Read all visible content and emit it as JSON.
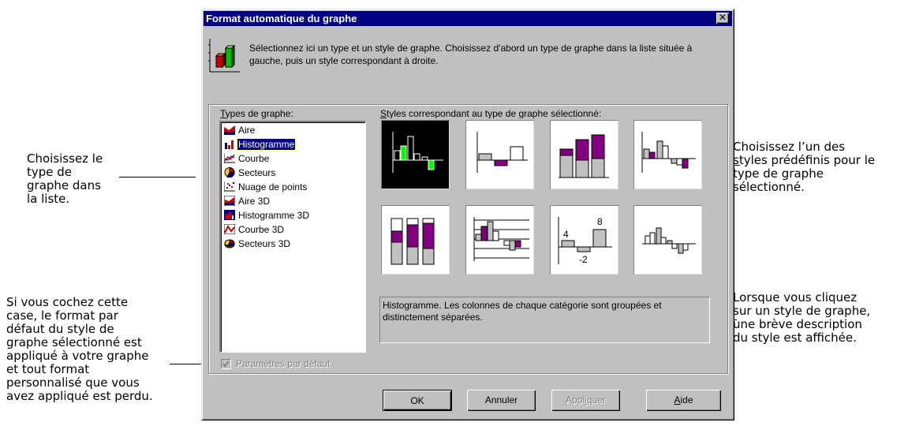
{
  "dialog": {
    "title": "Format automatique du graphe",
    "intro": "Sélectionnez ici un type et un style de graphe. Choisissez d'abord un type de graphe dans la liste située à gauche, puis un style correspondant à droite.",
    "types_label_first": "T",
    "types_label_rest": "ypes de graphe:",
    "styles_label_first": "S",
    "styles_label_rest": "tyles correspondant au type de graphe sélectionné:",
    "chart_types": [
      {
        "label": "Aire",
        "icon": "area-chart-icon"
      },
      {
        "label": "Histogramme",
        "icon": "column-chart-icon",
        "selected": true
      },
      {
        "label": "Courbe",
        "icon": "line-chart-icon"
      },
      {
        "label": "Secteurs",
        "icon": "pie-chart-icon"
      },
      {
        "label": "Nuage de points",
        "icon": "scatter-chart-icon"
      },
      {
        "label": "Aire 3D",
        "icon": "area-3d-chart-icon"
      },
      {
        "label": "Histogramme 3D",
        "icon": "column-3d-chart-icon"
      },
      {
        "label": "Courbe 3D",
        "icon": "line-3d-chart-icon"
      },
      {
        "label": "Secteurs 3D",
        "icon": "pie-3d-chart-icon"
      }
    ],
    "style_labels": {
      "val_4": "4",
      "val_neg2": "-2",
      "val_8": "8"
    },
    "description": "Histogramme. Les colonnes de chaque catégorie sont groupées et distinctement séparées.",
    "checkbox_label": "Paramètres par défaut",
    "buttons": {
      "ok": "OK",
      "cancel": "Annuler",
      "apply_pre": "Appl",
      "apply_u": "i",
      "apply_post": "quer",
      "help_u": "A",
      "help_post": "ide"
    }
  },
  "callouts": {
    "left_top": [
      "Choisissez le",
      "type de",
      "graphe dans",
      "la liste."
    ],
    "left_bottom": [
      "Si vous cochez cette",
      "case, le format par",
      "défaut du style de",
      "graphe sélectionné est",
      "appliqué à votre graphe",
      "et tout format",
      "personnalisé que vous",
      "avez appliqué est perdu."
    ],
    "right_top": [
      "Choisissez l’un des",
      "styles prédéfinis pour le",
      "type de graphe",
      "sélectionné."
    ],
    "right_bottom": [
      "Lorsque vous cliquez",
      "sur un style de graphe,",
      "une brève description",
      "du style est affichée."
    ]
  },
  "colors": {
    "title_bar": "#000080",
    "accent": "#800080",
    "bar_gray": "#c0c0c0"
  }
}
